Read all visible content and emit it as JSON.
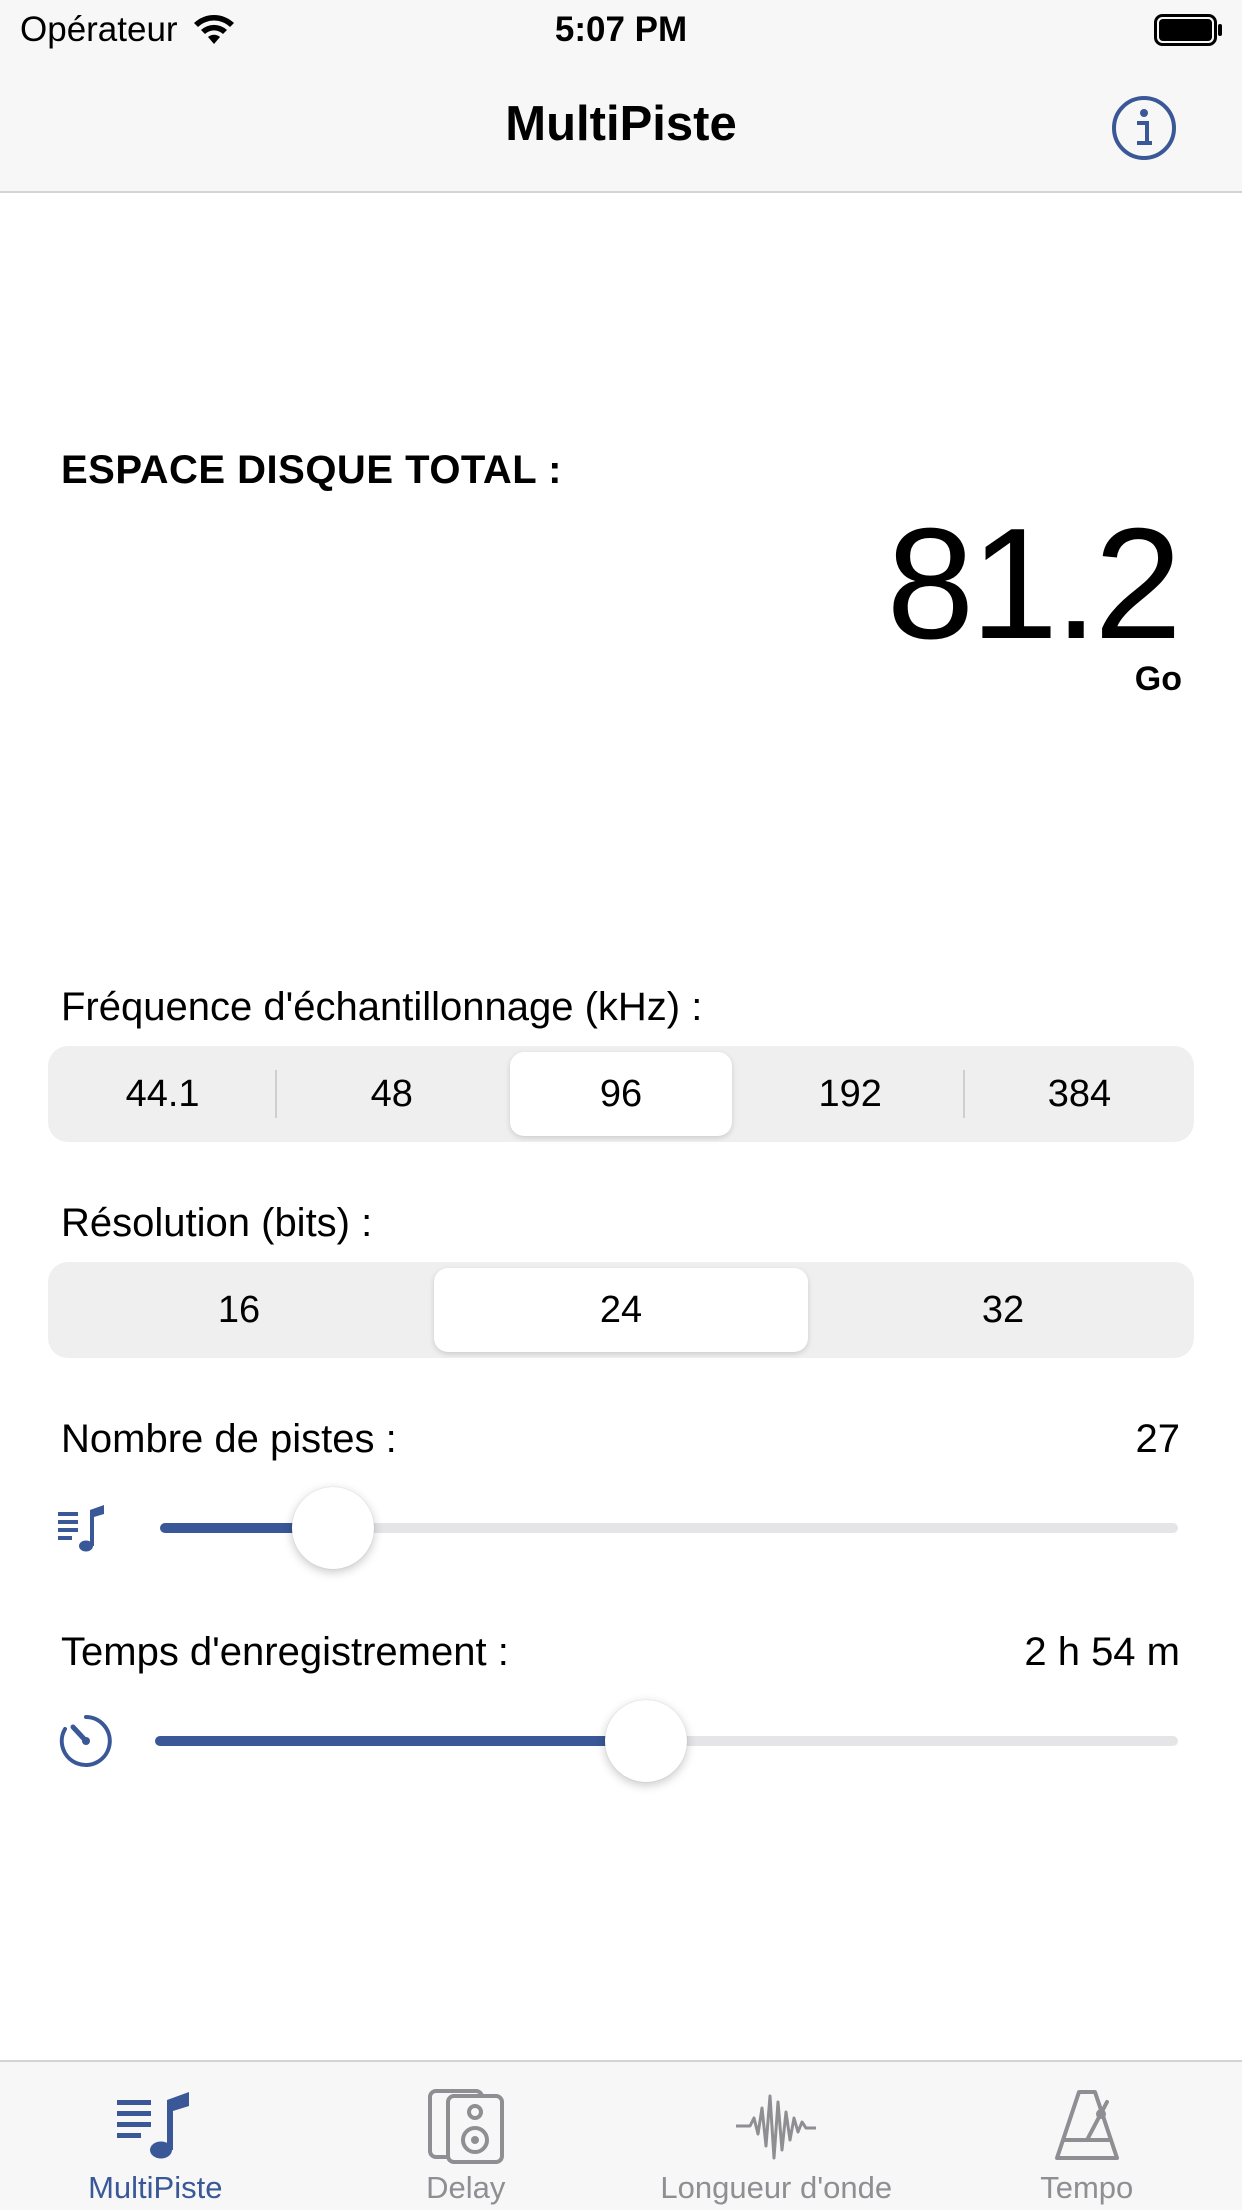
{
  "status_bar": {
    "carrier": "Opérateur",
    "time": "5:07 PM"
  },
  "nav": {
    "title": "MultiPiste"
  },
  "disk": {
    "label": "ESPACE DISQUE TOTAL :",
    "value": "81.2",
    "unit": "Go"
  },
  "sample_rate": {
    "label": "Fréquence d'échantillonnage (kHz) :",
    "options": [
      "44.1",
      "48",
      "96",
      "192",
      "384"
    ],
    "selected": "96"
  },
  "resolution": {
    "label": "Résolution (bits) :",
    "options": [
      "16",
      "24",
      "32"
    ],
    "selected": "24"
  },
  "tracks": {
    "label": "Nombre de pistes :",
    "value": "27",
    "slider_fraction": 0.17
  },
  "record_time": {
    "label": "Temps d'enregistrement :",
    "value": "2 h 54 m",
    "slider_fraction": 0.48
  },
  "tabs": [
    {
      "label": "MultiPiste",
      "icon": "music-list-icon",
      "active": true
    },
    {
      "label": "Delay",
      "icon": "speaker-icon",
      "active": false
    },
    {
      "label": "Longueur d'onde",
      "icon": "waveform-icon",
      "active": false
    },
    {
      "label": "Tempo",
      "icon": "metronome-icon",
      "active": false
    }
  ],
  "colors": {
    "accent": "#3a5897",
    "inactive": "#8e8e93"
  }
}
